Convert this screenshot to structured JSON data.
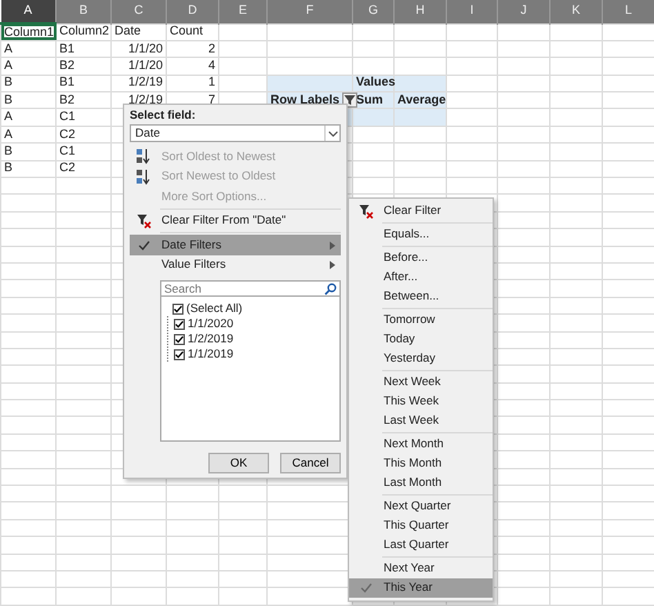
{
  "sheet": {
    "columns": [
      {
        "label": "A",
        "selected": true
      },
      {
        "label": "B",
        "selected": false
      },
      {
        "label": "C",
        "selected": false
      },
      {
        "label": "D",
        "selected": false
      },
      {
        "label": "E",
        "selected": false
      },
      {
        "label": "F",
        "selected": false
      },
      {
        "label": "G",
        "selected": false
      },
      {
        "label": "H",
        "selected": false
      },
      {
        "label": "I",
        "selected": false
      },
      {
        "label": "J",
        "selected": false
      },
      {
        "label": "K",
        "selected": false
      },
      {
        "label": "L",
        "selected": false
      }
    ],
    "rows": [
      [
        "Column1",
        "Column2",
        "Date",
        "Count"
      ],
      [
        "A",
        "B1",
        "1/1/20",
        "2"
      ],
      [
        "A",
        "B2",
        "1/1/20",
        "4"
      ],
      [
        "B",
        "B1",
        "1/2/19",
        "1"
      ],
      [
        "B",
        "B2",
        "1/2/19",
        "7"
      ],
      [
        "A",
        "C1"
      ],
      [
        "A",
        "C2"
      ],
      [
        "B",
        "C1"
      ],
      [
        "B",
        "C2"
      ]
    ],
    "pivot": {
      "values_label": "Values",
      "row_labels": "Row Labels",
      "value_columns": [
        "Sum",
        "Average"
      ]
    }
  },
  "filter_menu": {
    "field_label": "Select field:",
    "field_value": "Date",
    "items": [
      {
        "kind": "sort_ascending",
        "label": "Sort Oldest to Newest",
        "disabled": true,
        "selected": false
      },
      {
        "kind": "sort_descending",
        "label": "Sort Newest to Oldest",
        "disabled": true,
        "selected": false
      },
      {
        "kind": "text",
        "label": "More Sort Options...",
        "disabled": true,
        "selected": false
      },
      {
        "kind": "clear_filter",
        "label": "Clear Filter From \"Date\"",
        "disabled": false,
        "selected": false
      },
      {
        "kind": "submenu",
        "label": "Date Filters",
        "disabled": false,
        "selected": true
      },
      {
        "kind": "submenu",
        "label": "Value Filters",
        "disabled": false,
        "selected": false
      }
    ],
    "search": {
      "placeholder": "Search"
    },
    "values": [
      {
        "label": "(Select All)",
        "checked": true,
        "children": [
          {
            "label": "1/1/2020",
            "checked": true
          },
          {
            "label": "1/2/2019",
            "checked": true
          },
          {
            "label": "1/1/2019",
            "checked": true
          }
        ]
      }
    ],
    "buttons": [
      "OK",
      "Cancel"
    ]
  },
  "date_filters_menu": {
    "groups": [
      [
        {
          "kind": "clear_filter",
          "label": "Clear Filter",
          "selected": false
        }
      ],
      [
        {
          "kind": "text",
          "label": "Equals...",
          "selected": false
        }
      ],
      [
        {
          "kind": "text",
          "label": "Before...",
          "selected": false
        },
        {
          "kind": "text",
          "label": "After...",
          "selected": false
        },
        {
          "kind": "text",
          "label": "Between...",
          "selected": false
        }
      ],
      [
        {
          "kind": "text",
          "label": "Tomorrow",
          "selected": false
        },
        {
          "kind": "text",
          "label": "Today",
          "selected": false
        },
        {
          "kind": "text",
          "label": "Yesterday",
          "selected": false
        }
      ],
      [
        {
          "kind": "text",
          "label": "Next Week",
          "selected": false
        },
        {
          "kind": "text",
          "label": "This Week",
          "selected": false
        },
        {
          "kind": "text",
          "label": "Last Week",
          "selected": false
        }
      ],
      [
        {
          "kind": "text",
          "label": "Next Month",
          "selected": false
        },
        {
          "kind": "text",
          "label": "This Month",
          "selected": false
        },
        {
          "kind": "text",
          "label": "Last Month",
          "selected": false
        }
      ],
      [
        {
          "kind": "text",
          "label": "Next Quarter",
          "selected": false
        },
        {
          "kind": "text",
          "label": "This Quarter",
          "selected": false
        },
        {
          "kind": "text",
          "label": "Last Quarter",
          "selected": false
        }
      ],
      [
        {
          "kind": "text",
          "label": "Next Year",
          "selected": false
        },
        {
          "kind": "text",
          "label": "This Year",
          "selected": true
        }
      ]
    ]
  }
}
